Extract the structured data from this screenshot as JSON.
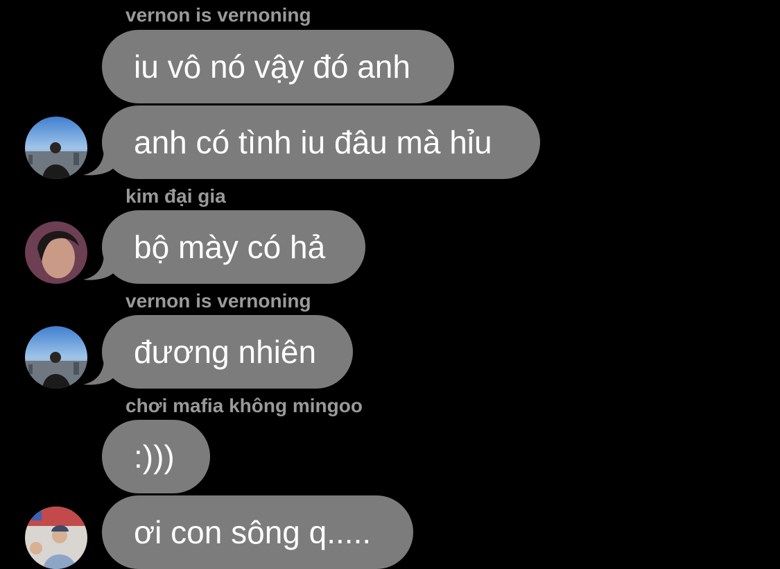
{
  "messages": [
    {
      "sender": "vernon is vernoning",
      "text": "iu vô nó vậy đó anh"
    },
    {
      "text": "anh có tình iu đâu mà hỉu"
    },
    {
      "sender": "kim đại gia",
      "text": "bộ mày có hả"
    },
    {
      "sender": "vernon is vernoning",
      "text": "đương nhiên"
    },
    {
      "sender": "chơi mafia không mingoo",
      "text": ":)))"
    },
    {
      "text": "ơi con sông q....."
    }
  ],
  "colors": {
    "bubble": "#7c7c7c",
    "background": "#000000",
    "sender": "#9a9a9a",
    "text": "#ffffff"
  }
}
